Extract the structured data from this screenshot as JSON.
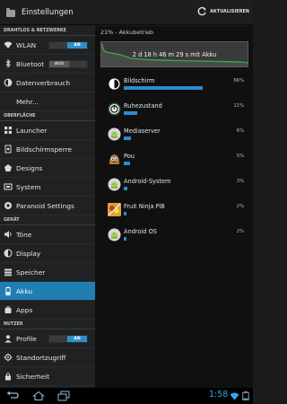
{
  "action_bar": {
    "title": "Einstellungen",
    "refresh_label": "AKTUALISIEREN",
    "icon": "settings-folder-icon"
  },
  "sidebar": {
    "sections": [
      {
        "header": "DRAHTLOS & NETZWERKE",
        "items": [
          {
            "label": "WLAN",
            "icon": "wifi-icon",
            "toggle": "AN",
            "toggle_state": "on"
          },
          {
            "label": "Bluetoot",
            "icon": "bluetooth-icon",
            "toggle": "AUS",
            "toggle_state": "off"
          },
          {
            "label": "Datenverbrauch",
            "icon": "data-usage-icon"
          },
          {
            "label": "Mehr...",
            "icon": ""
          }
        ]
      },
      {
        "header": "OBERFLÄCHE",
        "items": [
          {
            "label": "Launcher",
            "icon": "launcher-icon"
          },
          {
            "label": "Bildschirmsperre",
            "icon": "lockscreen-icon"
          },
          {
            "label": "Designs",
            "icon": "themes-icon"
          },
          {
            "label": "System",
            "icon": "system-icon"
          },
          {
            "label": "Paranoid Settings",
            "icon": "paranoid-icon"
          }
        ]
      },
      {
        "header": "GERÄT",
        "items": [
          {
            "label": "Töne",
            "icon": "sound-icon"
          },
          {
            "label": "Display",
            "icon": "display-icon"
          },
          {
            "label": "Speicher",
            "icon": "storage-icon"
          },
          {
            "label": "Akku",
            "icon": "battery-icon",
            "active": true
          },
          {
            "label": "Apps",
            "icon": "apps-icon"
          }
        ]
      },
      {
        "header": "NUTZER",
        "items": [
          {
            "label": "Profile",
            "icon": "profile-icon",
            "toggle": "AN",
            "toggle_state": "on"
          },
          {
            "label": "Standortzugriff",
            "icon": "location-icon"
          },
          {
            "label": "Sicherheit",
            "icon": "security-icon"
          }
        ]
      }
    ]
  },
  "battery": {
    "summary": "21% - Akkubetrieb",
    "graph_label": "2 d 18 h 46 m 29 s mit Akku",
    "graph_curve": [
      [
        0,
        0.05
      ],
      [
        0.02,
        0.35
      ],
      [
        0.05,
        0.4
      ],
      [
        0.13,
        0.48
      ],
      [
        0.2,
        0.62
      ],
      [
        0.28,
        0.66
      ],
      [
        0.4,
        0.69
      ],
      [
        0.55,
        0.71
      ],
      [
        0.7,
        0.73
      ],
      [
        0.86,
        0.75
      ],
      [
        0.95,
        0.76
      ],
      [
        1.0,
        0.8
      ]
    ],
    "apps": [
      {
        "name": "Bildschirm",
        "percent_label": "66%",
        "value": 66,
        "icon": "screen-icon"
      },
      {
        "name": "Ruhezustand",
        "percent_label": "11%",
        "value": 11,
        "icon": "standby-icon"
      },
      {
        "name": "Mediaserver",
        "percent_label": "6%",
        "value": 6,
        "icon": "android-icon"
      },
      {
        "name": "Pou",
        "percent_label": "5%",
        "value": 5,
        "icon": "pou-app-icon"
      },
      {
        "name": "Android-System",
        "percent_label": "3%",
        "value": 3,
        "icon": "android-icon"
      },
      {
        "name": "Fruit Ninja PiB",
        "percent_label": "2%",
        "value": 2,
        "icon": "fruit-ninja-icon"
      },
      {
        "name": "Android OS",
        "percent_label": "2%",
        "value": 2,
        "icon": "android-icon"
      }
    ]
  },
  "navbar": {
    "clock": "1:58"
  },
  "colors": {
    "accent": "#2e8bce",
    "active_item": "#1f7fb3",
    "clock": "#34a7e4",
    "graph_line": "#3aa346"
  }
}
